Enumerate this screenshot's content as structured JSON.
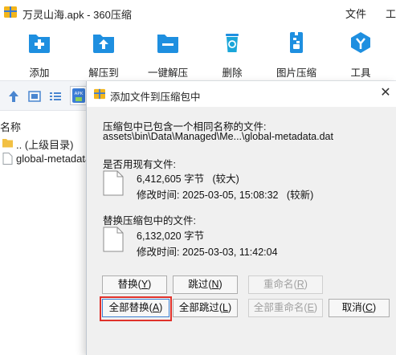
{
  "window": {
    "title": "万灵山海.apk - 360压缩",
    "menu": [
      "文件",
      "工"
    ]
  },
  "toolbar": {
    "items": [
      {
        "label": "添加",
        "icon": "add-icon"
      },
      {
        "label": "解压到",
        "icon": "extract-to-icon"
      },
      {
        "label": "一键解压",
        "icon": "one-click-extract-icon"
      },
      {
        "label": "删除",
        "icon": "delete-icon"
      },
      {
        "label": "图片压缩",
        "icon": "image-compress-icon"
      },
      {
        "label": "工具",
        "icon": "tools-icon"
      }
    ],
    "colors": {
      "accent": "#1e8fe0",
      "recycle": "#1aa6d9"
    }
  },
  "navbar": {
    "icons": [
      "up-arrow-icon",
      "view-icon",
      "list-icon",
      "apk-tab-icon"
    ],
    "apk_tab_text": "APK"
  },
  "filelist": {
    "column_header": "名称",
    "rows": [
      {
        "name": ".. (上级目录)",
        "icon": "folder-icon"
      },
      {
        "name": "global-metadata",
        "icon": "file-icon"
      }
    ]
  },
  "dialog": {
    "title": "添加文件到压缩包中",
    "message_line1": "压缩包中已包含一个相同名称的文件:",
    "message_line2": "assets\\bin\\Data\\Managed\\Me...\\global-metadata.dat",
    "existing": {
      "label": "是否用现有文件:",
      "size": "6,412,605 字节",
      "size_note": "(较大)",
      "modified": "修改时间: 2025-03-05, 15:08:32",
      "modified_note": "(较新)"
    },
    "replacement": {
      "label": "替换压缩包中的文件:",
      "size": "6,132,020 字节",
      "modified": "修改时间: 2025-03-03, 11:42:04"
    },
    "buttons": {
      "replace": {
        "text": "替换",
        "key": "Y"
      },
      "skip": {
        "text": "跳过",
        "key": "N"
      },
      "rename": {
        "text": "重命名",
        "key": "R"
      },
      "replace_all": {
        "text": "全部替换",
        "key": "A"
      },
      "skip_all": {
        "text": "全部跳过",
        "key": "L"
      },
      "rename_all": {
        "text": "全部重命名",
        "key": "E"
      },
      "cancel": {
        "text": "取消",
        "key": "C"
      }
    },
    "highlight_color": "#e0312b"
  }
}
